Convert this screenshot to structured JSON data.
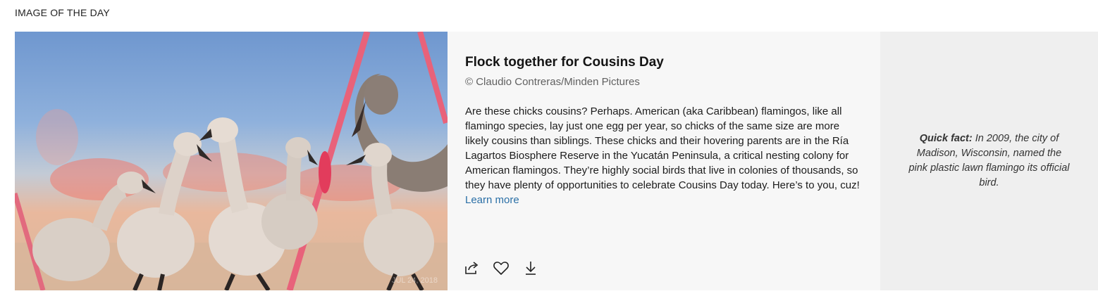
{
  "section": {
    "title": "IMAGE OF THE DAY"
  },
  "image": {
    "date_overlay": "JUL 24, 2018"
  },
  "article": {
    "headline": "Flock together for Cousins Day",
    "credit": "© Claudio Contreras/Minden Pictures",
    "description": "Are these chicks cousins? Perhaps. American (aka Caribbean) flamingos, like all flamingo species, lay just one egg per year, so chicks of the same size are more likely cousins than siblings. These chicks and their hovering parents are in the Ría Lagartos Biosphere Reserve in the Yucatán Peninsula, a critical nesting colony for American flamingos. They’re highly social birds that live in colonies of thousands, so they have plenty of opportunities to celebrate Cousins Day today. Here’s to you, cuz!",
    "learn_more": "Learn more"
  },
  "actions": [
    {
      "icon": "share-icon"
    },
    {
      "icon": "heart-icon"
    },
    {
      "icon": "download-icon"
    }
  ],
  "fact": {
    "label": "Quick fact:",
    "text": "In 2009, the city of Madison, Wisconsin, named the pink plastic lawn flamingo its official bird."
  },
  "colors": {
    "link": "#2a6fa6",
    "content_bg": "#f7f7f7",
    "fact_bg": "#efefef"
  }
}
